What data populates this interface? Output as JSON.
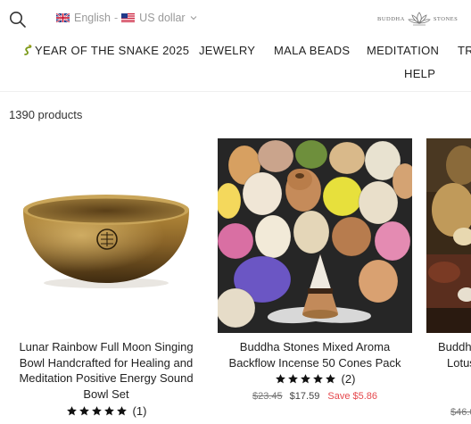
{
  "header": {
    "language": "English",
    "separator": "-",
    "currency": "US dollar",
    "logo_left": "BUDDHA",
    "logo_right": "STONES"
  },
  "nav": {
    "items": [
      {
        "label": "YEAR OF THE SNAKE 2025"
      },
      {
        "label": "JEWELRY"
      },
      {
        "label": "MALA BEADS"
      },
      {
        "label": "MEDITATION"
      },
      {
        "label": "TR"
      },
      {
        "label": "HELP"
      }
    ]
  },
  "listing": {
    "count_label": "1390 products"
  },
  "products": [
    {
      "title": "Lunar Rainbow Full Moon Singing Bowl Handcrafted for Healing and Meditation Positive Energy Sound Bowl Set",
      "rating": 5,
      "reviews": "(1)"
    },
    {
      "title": "Buddha Stones Mixed Aroma Backflow Incense 50 Cones Pack",
      "rating": 5,
      "reviews": "(2)",
      "old_price": "$23.45",
      "price": "$17.59",
      "save": "Save $5.86"
    },
    {
      "title": "Buddh",
      "title_line2": "Lotus",
      "old_price": "$46.0"
    }
  ],
  "colors": {
    "sale": "#e5484d",
    "text": "#222222",
    "muted": "#999999"
  }
}
